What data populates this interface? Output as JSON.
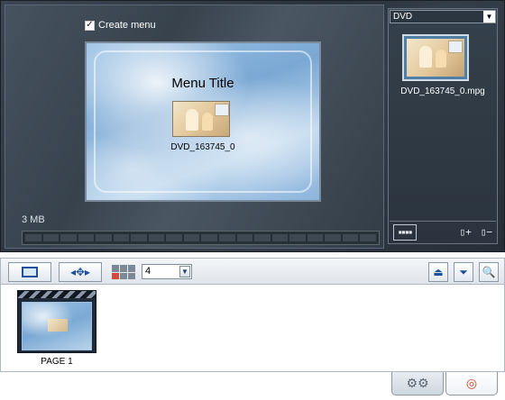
{
  "preview": {
    "create_menu_label": "Create menu",
    "create_menu_checked": true,
    "menu_title": "Menu Title",
    "menu_item_label": "DVD_163745_0",
    "size_label": "3 MB",
    "capacity_fraction": 0.0
  },
  "media_pane": {
    "source_select": "DVD",
    "file_name": "DVD_163745_0.mpg",
    "icons": [
      "film-strip-icon",
      "add-page-icon",
      "remove-page-icon"
    ]
  },
  "toolbar": {
    "layout_count": "4",
    "icons": [
      "monitor-icon",
      "move-arrows-icon",
      "layout-grid-icon",
      "move-up-icon",
      "move-down-icon",
      "zoom-icon"
    ]
  },
  "pages": [
    {
      "label": "PAGE 1"
    }
  ],
  "tabs": [
    "settings-gear-icon",
    "burn-disc-icon"
  ]
}
